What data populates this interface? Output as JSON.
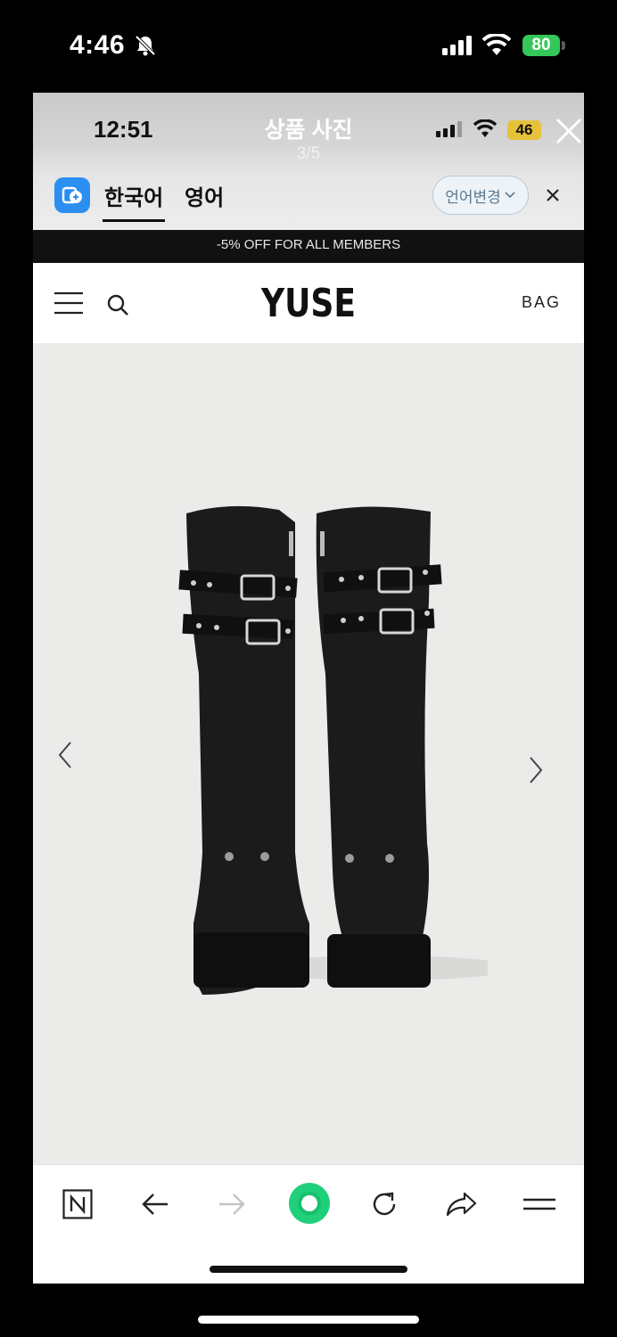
{
  "outer_status": {
    "time": "4:46",
    "battery": "80"
  },
  "viewer": {
    "time": "12:51",
    "title": "상품 사진",
    "counter": "3/5",
    "battery": "46"
  },
  "translate_bar": {
    "tabs": [
      "한국어",
      "영어"
    ],
    "active_tab": 0,
    "change_button": "언어변경"
  },
  "promo": {
    "text": "-5% OFF FOR ALL MEMBERS"
  },
  "site_header": {
    "brand": "YUSE",
    "bag_label": "BAG"
  },
  "icons": {
    "status": [
      "bell-slash-icon",
      "signal-icon",
      "wifi-icon",
      "battery-icon"
    ],
    "viewer": [
      "close-icon"
    ],
    "translate": [
      "translate-app-icon",
      "chevron-down-icon",
      "close-icon"
    ],
    "site": [
      "menu-icon",
      "search-icon"
    ],
    "gallery": [
      "chevron-left-icon",
      "chevron-right-icon"
    ],
    "toolbar": [
      "naver-n-icon",
      "back-arrow-icon",
      "forward-arrow-icon",
      "green-dot-icon",
      "reload-icon",
      "share-icon",
      "menu-icon"
    ]
  },
  "colors": {
    "accent_green": "#1fcf7a",
    "battery_green": "#34c759",
    "battery_yellow": "#e6c23b"
  }
}
